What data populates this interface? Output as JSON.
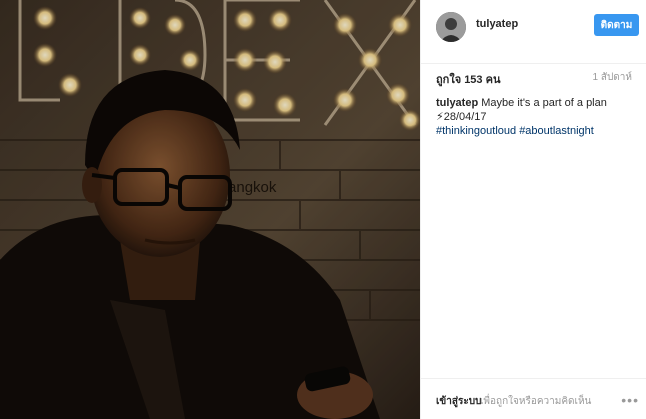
{
  "post": {
    "username": "tulyatep",
    "follow_label": "ติดตาม",
    "likes": "ถูกใจ 153 คน",
    "time_ago": "1 สัปดาห์",
    "caption": {
      "user": "tulyatep",
      "text": "Maybe it's a part of a plan",
      "date": "⚡28/04/17",
      "hashtags": [
        "#thinkingoutloud",
        "#aboutlastnight"
      ]
    },
    "sign_text": "DEX",
    "sign_subtext": "Bangkok",
    "footer": {
      "login_label": "เข้าสู่ระบบ",
      "login_prompt": "เพื่อถูกใจหรือความคิดเห็น",
      "more_icon": "more-icon"
    }
  },
  "colors": {
    "follow_button": "#3897f0",
    "hashtag": "#003569"
  }
}
